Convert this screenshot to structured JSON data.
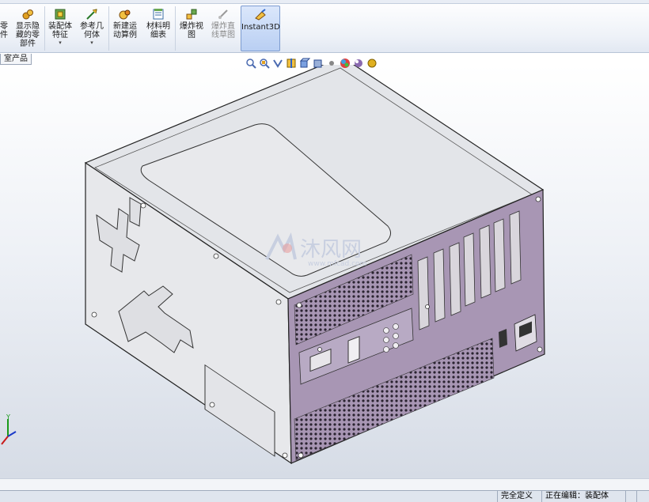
{
  "toolbar": {
    "buttons": [
      {
        "label": "零\n件",
        "icon": "part-icon"
      },
      {
        "label": "显示隐\n藏的零\n部件",
        "icon": "show-hidden-components-icon"
      },
      {
        "label": "装配体\n特征",
        "icon": "assembly-feature-icon"
      },
      {
        "label": "参考几\n何体",
        "icon": "reference-geometry-icon"
      },
      {
        "label": "新建运\n动算例",
        "icon": "new-motion-study-icon"
      },
      {
        "label": "材料明\n细表",
        "icon": "bill-of-materials-icon"
      },
      {
        "label": "爆炸视\n图",
        "icon": "exploded-view-icon"
      },
      {
        "label": "爆炸直\n线草图",
        "icon": "explode-line-sketch-icon"
      },
      {
        "label": "Instant3D",
        "icon": "instant3d-icon"
      }
    ]
  },
  "tab_label": "室产品",
  "watermark": {
    "text": "沐风网",
    "url": "www.mfcad.com"
  },
  "statusbar": {
    "fully_defined": "完全定义",
    "editing": "正在编辑：装配体"
  },
  "colors": {
    "panel_purple": "#a896b4",
    "case_gray": "#e2e4e8",
    "active_button": "#b9cff3"
  }
}
